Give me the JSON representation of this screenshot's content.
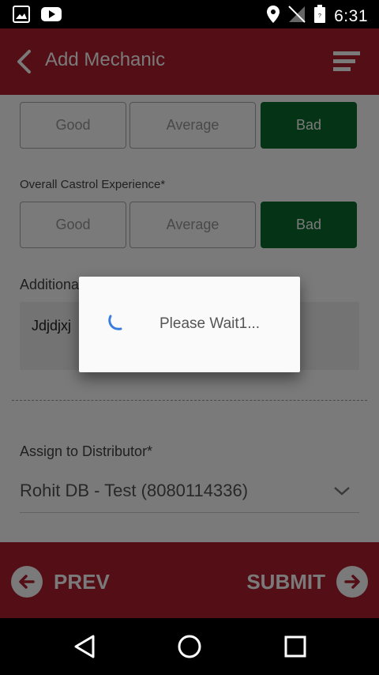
{
  "status_bar": {
    "time": "6:31",
    "left_icons": [
      "image-icon",
      "youtube-icon"
    ],
    "right_icons": [
      "location-icon",
      "no-signal-icon",
      "battery-icon"
    ]
  },
  "app_bar": {
    "title": "Add Mechanic",
    "back_icon": "chevron-left-icon",
    "menu_icon": "menu-icon"
  },
  "first_rating": {
    "options": [
      "Good",
      "Average",
      "Bad"
    ],
    "selected": "Bad"
  },
  "overall_experience": {
    "label": "Overall Castrol Experience*",
    "options": [
      "Good",
      "Average",
      "Bad"
    ],
    "selected": "Bad"
  },
  "remarks": {
    "label": "Additiona",
    "value": "Jdjdjxj"
  },
  "assign": {
    "label": "Assign to Distributor*",
    "value": "Rohit DB - Test (8080114336)"
  },
  "bottom_bar": {
    "prev_label": "PREV",
    "submit_label": "SUBMIT"
  },
  "dialog": {
    "message": "Please Wait1..."
  },
  "colors": {
    "brand_red": "#b01e2e",
    "selected_green": "#0a6e2c",
    "spinner_blue": "#3a7de0"
  }
}
